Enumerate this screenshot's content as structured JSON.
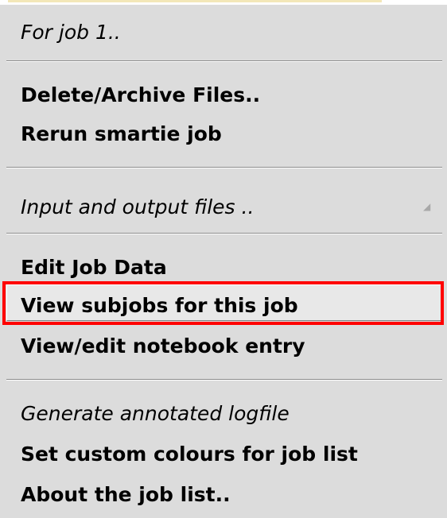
{
  "menu": {
    "items": [
      {
        "label": "For job 1..",
        "style": "italic"
      },
      {
        "label": "Delete/Archive Files..",
        "style": "bold"
      },
      {
        "label": "Rerun smartie job",
        "style": "bold"
      },
      {
        "label": "Input and output files ..",
        "style": "italic",
        "submenu": true
      },
      {
        "label": "Edit Job Data",
        "style": "bold"
      },
      {
        "label": "View subjobs for this job",
        "style": "bold",
        "highlighted": true
      },
      {
        "label": "View/edit notebook entry",
        "style": "bold"
      },
      {
        "label": "Generate annotated logfile",
        "style": "italic"
      },
      {
        "label": "Set custom colours for job list",
        "style": "bold"
      },
      {
        "label": "About the job list..",
        "style": "bold"
      }
    ],
    "submenu_arrow_icon": "submenu-arrow-icon",
    "colors": {
      "background": "#dcdcdc",
      "highlight_row": "#e8e8e8",
      "annotation_box": "#ff0000",
      "separator": "#8c8c8c"
    }
  }
}
